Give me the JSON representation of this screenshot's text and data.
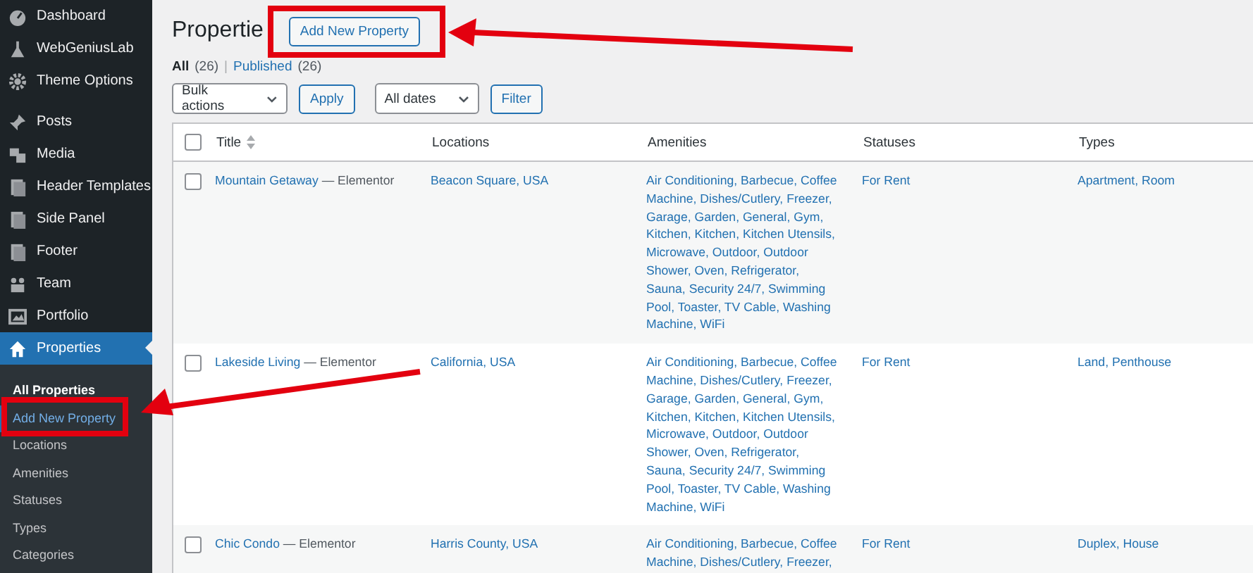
{
  "sidebar": {
    "items": [
      {
        "label": "Dashboard",
        "selected": false,
        "group_start": false
      },
      {
        "label": "WebGeniusLab",
        "selected": false,
        "group_start": false
      },
      {
        "label": "Theme Options",
        "selected": false,
        "group_start": false
      },
      {
        "label": "Posts",
        "selected": false,
        "group_start": true
      },
      {
        "label": "Media",
        "selected": false,
        "group_start": false
      },
      {
        "label": "Header Templates",
        "selected": false,
        "group_start": false
      },
      {
        "label": "Side Panel",
        "selected": false,
        "group_start": false
      },
      {
        "label": "Footer",
        "selected": false,
        "group_start": false
      },
      {
        "label": "Team",
        "selected": false,
        "group_start": false
      },
      {
        "label": "Portfolio",
        "selected": false,
        "group_start": false
      },
      {
        "label": "Properties",
        "selected": true,
        "group_start": false
      }
    ],
    "submenu": [
      {
        "label": "All Properties",
        "selected": true,
        "highlighted": false
      },
      {
        "label": "Add New Property",
        "selected": false,
        "highlighted": true
      },
      {
        "label": "Locations",
        "selected": false,
        "highlighted": false
      },
      {
        "label": "Amenities",
        "selected": false,
        "highlighted": false
      },
      {
        "label": "Statuses",
        "selected": false,
        "highlighted": false
      },
      {
        "label": "Types",
        "selected": false,
        "highlighted": false
      },
      {
        "label": "Categories",
        "selected": false,
        "highlighted": false
      }
    ]
  },
  "page": {
    "title": "Propertie",
    "add_button": "Add New Property",
    "views": [
      {
        "label": "All",
        "count": "(26)",
        "selected": true
      },
      {
        "label": "Published",
        "count": "(26)",
        "selected": false
      }
    ],
    "views_separator": "|",
    "bulk_actions": "Bulk actions",
    "apply": "Apply",
    "dates": "All dates",
    "filter": "Filter"
  },
  "table": {
    "header_checked": false,
    "columns": [
      "Title",
      "Locations",
      "Amenities",
      "Statuses",
      "Types"
    ],
    "rows": [
      {
        "checked": false,
        "title": "Mountain Getaway",
        "post_state": "— Elementor",
        "location": "Beacon Square, USA",
        "amenities": "Air Conditioning, Barbecue, Coffee Machine, Dishes/Cutlery, Freezer, Garage, Garden, General, Gym, Kitchen, Kitchen, Kitchen Utensils, Microwave, Outdoor, Outdoor Shower, Oven, Refrigerator, Sauna, Security 24/7, Swimming Pool, Toaster, TV Cable, Washing Machine, WiFi",
        "status": "For Rent",
        "types": "Apartment, Room"
      },
      {
        "checked": false,
        "title": "Lakeside Living",
        "post_state": "— Elementor",
        "location": "California, USA",
        "amenities": "Air Conditioning, Barbecue, Coffee Machine, Dishes/Cutlery, Freezer, Garage, Garden, General, Gym, Kitchen, Kitchen, Kitchen Utensils, Microwave, Outdoor, Outdoor Shower, Oven, Refrigerator, Sauna, Security 24/7, Swimming Pool, Toaster, TV Cable, Washing Machine, WiFi",
        "status": "For Rent",
        "types": "Land, Penthouse"
      },
      {
        "checked": false,
        "title": "Chic Condo",
        "post_state": "— Elementor",
        "location": "Harris County, USA",
        "amenities": "Air Conditioning, Barbecue, Coffee Machine, Dishes/Cutlery, Freezer,",
        "status": "For Rent",
        "types": "Duplex, House"
      }
    ]
  }
}
